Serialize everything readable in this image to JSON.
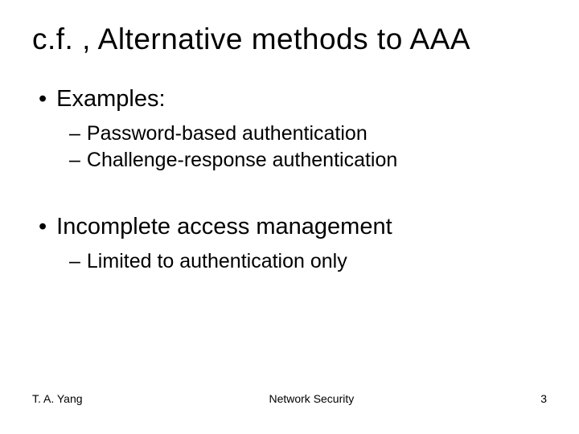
{
  "title": "c.f. , Alternative methods to AAA",
  "sections": [
    {
      "heading": "Examples:",
      "items": [
        "Password-based authentication",
        "Challenge-response authentication"
      ]
    },
    {
      "heading": "Incomplete access management",
      "items": [
        "Limited to authentication only"
      ]
    }
  ],
  "footer": {
    "author": "T. A. Yang",
    "course": "Network Security",
    "page": "3"
  }
}
